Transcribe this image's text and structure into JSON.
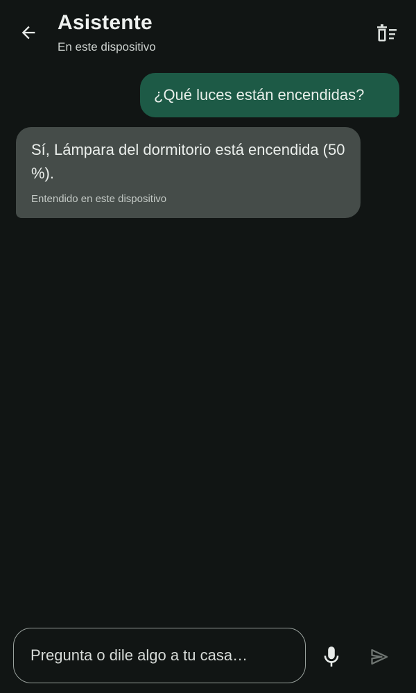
{
  "header": {
    "title": "Asistente",
    "subtitle": "En este dispositivo",
    "back_icon": "arrow-back-icon",
    "clear_icon": "clear-conversation-icon"
  },
  "conversation": {
    "messages": [
      {
        "role": "user",
        "text": "¿Qué luces están encendidas?"
      },
      {
        "role": "assistant",
        "text": "Sí, Lámpara del dormitorio está encendida (50 %).",
        "meta": "Entendido en este dispositivo"
      }
    ]
  },
  "composer": {
    "placeholder": "Pregunta o dile algo a tu casa…",
    "value": "",
    "mic_icon": "microphone-icon",
    "send_icon": "send-icon"
  },
  "colors": {
    "background": "#111514",
    "user_bubble": "#1d5a46",
    "assistant_bubble": "#454c49",
    "text": "#e6e9e7"
  }
}
